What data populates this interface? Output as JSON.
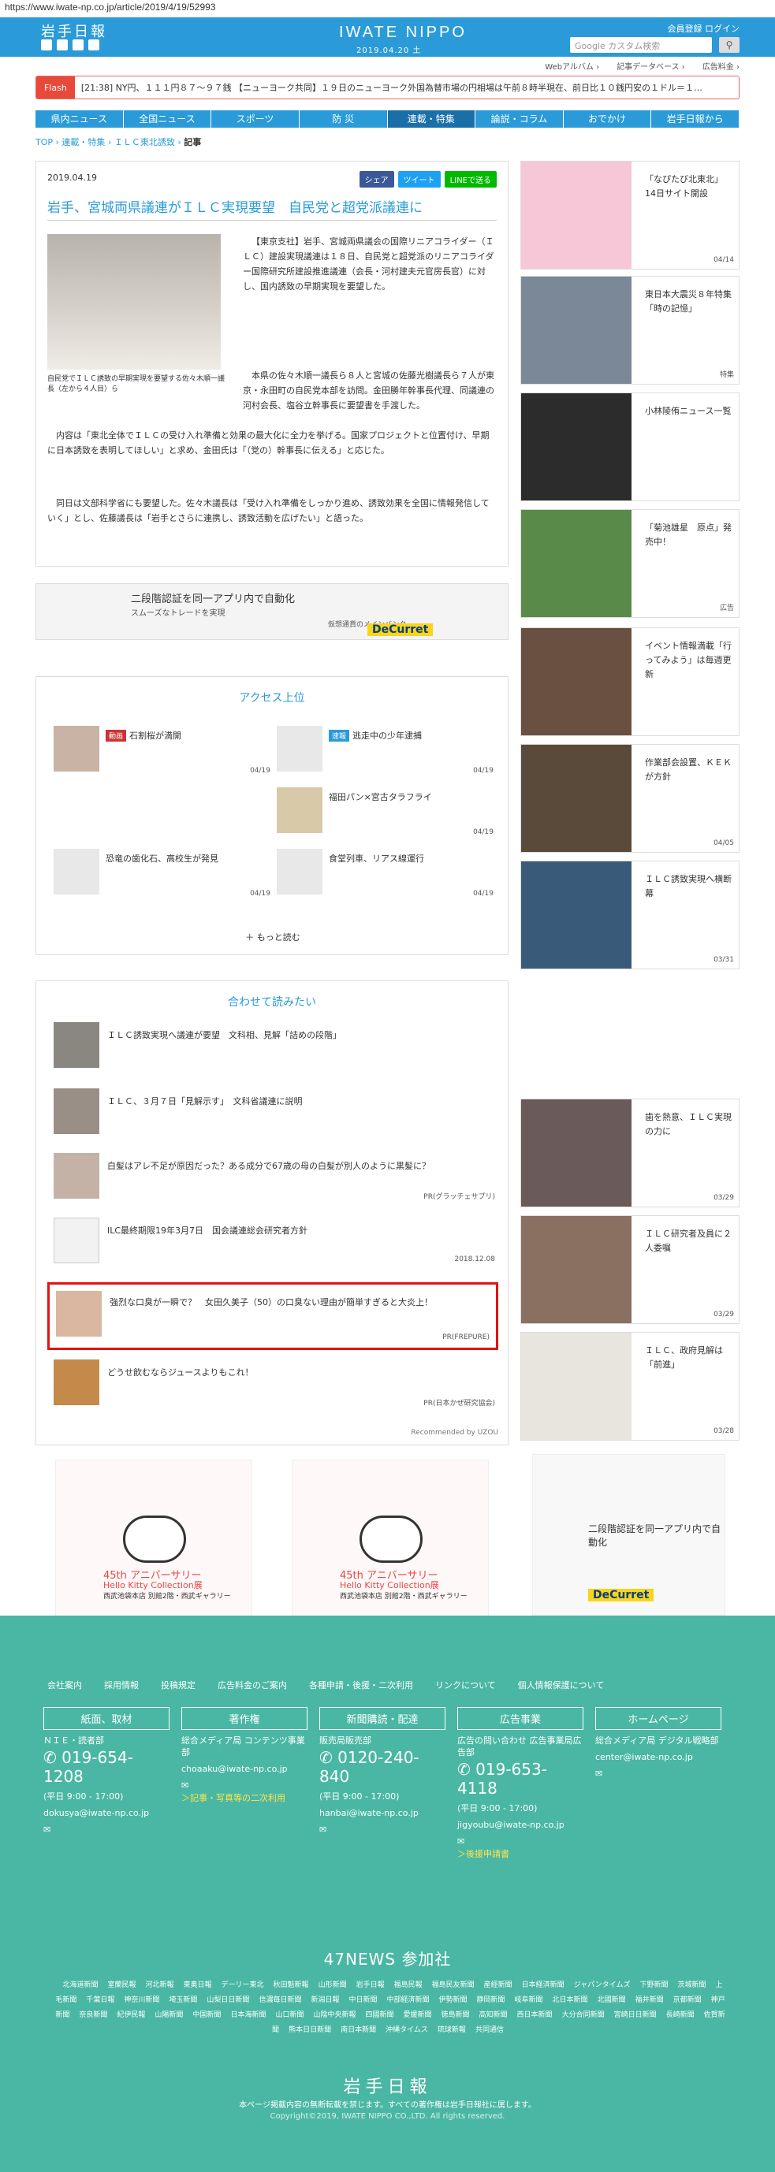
{
  "url": "https://www.iwate-np.co.jp/article/2019/4/19/52993",
  "header": {
    "logo": "岩手日報",
    "brand": "IWATE NIPPO",
    "date": "2019.04.20 土",
    "login": "会員登録 ログイン",
    "search_placeholder": "Google カスタム検索",
    "links": [
      "Webアルバム ›",
      "記事データベース ›",
      "広告料金 ›"
    ]
  },
  "flash": {
    "tag": "Flash",
    "text": "[21:38] NY円、１１１円８７～９７銭 【ニューヨーク共同】１９日のニューヨーク外国為替市場の円相場は午前８時半現在、前日比１０銭円安の１ドル＝１…"
  },
  "nav": [
    "県内ニュース",
    "全国ニュース",
    "スポーツ",
    "防 災",
    "連載・特集",
    "論説・コラム",
    "おでかけ",
    "岩手日報から"
  ],
  "breadcrumb": {
    "a": "TOP",
    "b": "連載・特集",
    "c": "ＩＬＣ東北誘致",
    "d": "記事"
  },
  "article": {
    "date": "2019.04.19",
    "share": [
      "シェア",
      "ツイート",
      "LINEで送る"
    ],
    "title": "岩手、宮城両県議連がＩＬＣ実現要望　自民党と超党派議連に",
    "caption": "自民党でＩＬＣ誘致の早期実現を要望する佐々木順一議長（左から４人目）ら",
    "p1": "【東京支社】岩手、宮城両県議会の国際リニアコライダー（ＩＬＣ）建設実現議連は１８日、自民党と超党派のリニアコライダー国際研究所建設推進議連（会長・河村建夫元官房長官）に対し、国内誘致の早期実現を要望した。",
    "p2": "本県の佐々木順一議長ら８人と宮城の佐藤光樹議長ら７人が東京・永田町の自民党本部を訪問。金田勝年幹事長代理、同議連の河村会長、塩谷立幹事長に要望書を手渡した。",
    "p3": "内容は「東北全体でＩＬＣの受け入れ準備と効果の最大化に全力を挙げる。国家プロジェクトと位置付け、早期に日本誘致を表明してほしい」と求め、金田氏は「（党の）幹事長に伝える」と応じた。",
    "p4": "同日は文部科学省にも要望した。佐々木議長は「受け入れ準備をしっかり進め、誘致効果を全国に情報発信していく」とし、佐藤議長は「岩手とさらに連携し、誘致活動を広げたい」と語った。"
  },
  "ad1": {
    "a": "二段階認証を同一アプリ内で自動化",
    "b": "スムーズなトレードを実現",
    "c": "仮想通貨のメインバンク",
    "d": "DeCurret"
  },
  "access": {
    "title": "アクセス上位",
    "items": [
      {
        "badge": "動画",
        "text": "石割桜が満開",
        "date": "04/19"
      },
      {
        "badge": "速報",
        "text": "逃走中の少年逮捕",
        "date": "04/19"
      },
      {
        "badge": "",
        "text": "福田パン×宮古タラフライ",
        "date": "04/19"
      },
      {
        "badge": "",
        "text": "恐竜の歯化石、高校生が発見",
        "date": "04/19"
      },
      {
        "badge": "",
        "text": "食堂列車、リアス線運行",
        "date": "04/19"
      }
    ],
    "more": "もっと読む"
  },
  "related": {
    "title": "合わせて読みたい",
    "items": [
      {
        "text": "ＩＬＣ誘致実現へ議連が要望　文科相、見解「詰めの段階」",
        "src": ""
      },
      {
        "text": "ＩＬＣ、３月７日「見解示す」　文科省議連に説明",
        "src": ""
      },
      {
        "text": "白髪はアレ不足が原因だった？ある成分で67歳の母の白髪が別人のように黒髪に？",
        "src": "PR(グラッチェサプリ)"
      },
      {
        "text": "ILC最終期限19年3月7日　国会議連総会研究者方針",
        "src": "2018.12.08"
      },
      {
        "text": "強烈な口臭が一瞬で？　女田久美子（50）の口臭ない理由が簡単すぎると大炎上！",
        "src": "PR(FREPURE)"
      },
      {
        "text": "どうせ飲むならジュースよりもこれ！",
        "src": "PR(日本かぜ研究協会)"
      }
    ],
    "foot": "Recommended by UZOU"
  },
  "ad2": {
    "t1": "45th アニバーサリー",
    "t2": "Hello Kitty Collection展",
    "t3": "西武池袋本店 別館2階・西武ギャラリー"
  },
  "sidebar": [
    {
      "text": "「なぴたび北東北」14日サイト開設",
      "date": "04/14"
    },
    {
      "text": "東日本大震災８年特集「時の記憶」",
      "date": "特集"
    },
    {
      "text": "小林陵侑ニュース一覧",
      "date": ""
    },
    {
      "text": "「菊池雄星　原点」発売中！",
      "date": "広告"
    },
    {
      "text": "イベント情報満載「行ってみよう」は毎週更新",
      "date": ""
    },
    {
      "text": "作業部会設置、ＫＥＫが方針",
      "date": "04/05"
    },
    {
      "text": "ＩＬＣ誘致実現へ横断幕",
      "date": "03/31"
    },
    {
      "text": "歯を熱意、ＩＬＣ実現の力に",
      "date": "03/29"
    },
    {
      "text": "ＩＬＣ研究者及員に２人委嘱",
      "date": "03/29"
    },
    {
      "text": "ＩＬＣ、政府見解は「前進」",
      "date": "03/28"
    }
  ],
  "footer": {
    "links": [
      "会社案内",
      "採用情報",
      "投稿規定",
      "広告料金のご案内",
      "各種申請・後援・二次利用",
      "リンクについて",
      "個人情報保護について"
    ],
    "cols": [
      {
        "h": "紙面、取材",
        "p": "ＮＩＥ・読者部",
        "tel": "019-654-1208",
        "hours": "(平日 9:00 - 17:00)",
        "mail": "dokusya@iwate-np.co.jp",
        "y": ""
      },
      {
        "h": "著作権",
        "p": "総合メディア局 コンテンツ事業部",
        "tel": "",
        "hours": "",
        "mail": "choaaku@iwate-np.co.jp",
        "y": "＞記事・写真等の二次利用"
      },
      {
        "h": "新聞購読・配達",
        "p": "販売局販売部",
        "tel": "0120-240-840",
        "hours": "(平日 9:00 - 17:00)",
        "mail": "hanbai@iwate-np.co.jp",
        "y": ""
      },
      {
        "h": "広告事業",
        "p": "広告の問い合わせ 広告事業局広告部",
        "tel": "019-653-4118",
        "hours": "(平日 9:00 - 17:00)",
        "mail": "jigyoubu@iwate-np.co.jp",
        "y": "＞後援申請書"
      },
      {
        "h": "ホームページ",
        "p": "総合メディア局 デジタル戦略部",
        "tel": "",
        "hours": "",
        "mail": "center@iwate-np.co.jp",
        "y": ""
      }
    ],
    "n47": "47NEWS 参加社",
    "papers": [
      "北海道新聞",
      "室蘭民報",
      "河北新報",
      "東奥日報",
      "デーリー東北",
      "秋田魁新報",
      "山形新聞",
      "岩手日報",
      "福島民報",
      "福島民友新聞",
      "産經新聞",
      "日本経済新聞",
      "ジャパンタイムズ",
      "下野新聞",
      "茨城新聞",
      "上毛新聞",
      "千葉日報",
      "神奈川新聞",
      "埼玉新聞",
      "山梨日日新聞",
      "信濃毎日新聞",
      "新潟日報",
      "中日新聞",
      "中部経済新聞",
      "伊勢新聞",
      "静岡新聞",
      "岐阜新聞",
      "北日本新聞",
      "北國新聞",
      "福井新聞",
      "京都新聞",
      "神戸新聞",
      "奈良新聞",
      "紀伊民報",
      "山陽新聞",
      "中国新聞",
      "日本海新聞",
      "山口新聞",
      "山陰中央新報",
      "四國新聞",
      "愛媛新聞",
      "徳島新聞",
      "高知新聞",
      "西日本新聞",
      "大分合同新聞",
      "宮崎日日新聞",
      "長崎新聞",
      "佐賀新聞",
      "熊本日日新聞",
      "南日本新聞",
      "沖縄タイムス",
      "琉球新報",
      "共同通信"
    ],
    "logo": "岩手日報",
    "notice": "本ページ掲載内容の無断転載を禁じます。すべての著作権は岩手日報社に属します。",
    "copyright": "Copyright©2019, IWATE NIPPO CO.,LTD. All rights reserved."
  }
}
